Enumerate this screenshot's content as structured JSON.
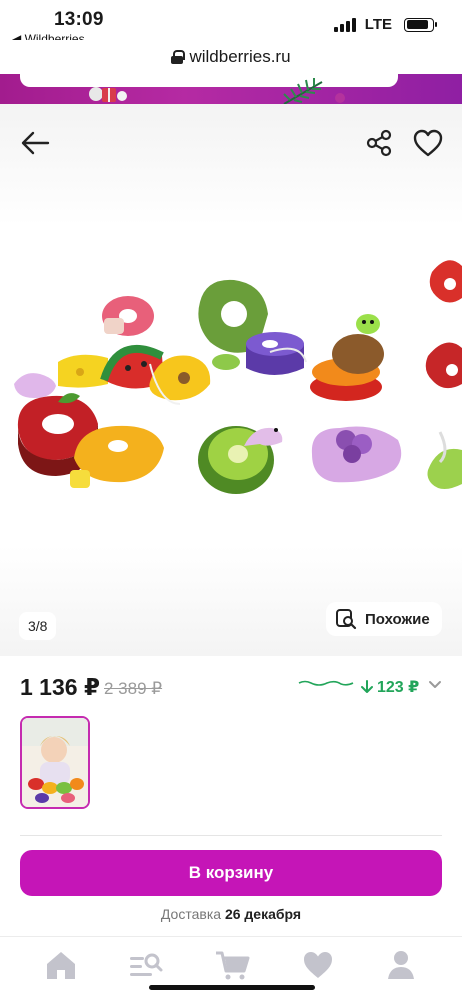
{
  "status_bar": {
    "time": "13:09",
    "back_app": "◀ Wildberries",
    "network": "LTE"
  },
  "browser": {
    "url": "wildberries.ru"
  },
  "gallery": {
    "counter": "3/8",
    "similar_label": "Похожие"
  },
  "price": {
    "current": "1 136 ₽",
    "old": "2 389 ₽",
    "drop": "123 ₽"
  },
  "actions": {
    "cart_label": "В корзину",
    "delivery_prefix": "Доставка",
    "delivery_date": "26 декабря"
  },
  "colors": {
    "brand": "#c515b7",
    "price_drop": "#22a55a",
    "banner": "#a21c8e"
  },
  "icons": {
    "back": "arrow-left-icon",
    "share": "share-icon",
    "favorite": "heart-icon",
    "similar": "search-similar-icon",
    "tabs": [
      "home-icon",
      "catalog-search-icon",
      "cart-icon",
      "favorites-icon",
      "profile-icon"
    ]
  }
}
